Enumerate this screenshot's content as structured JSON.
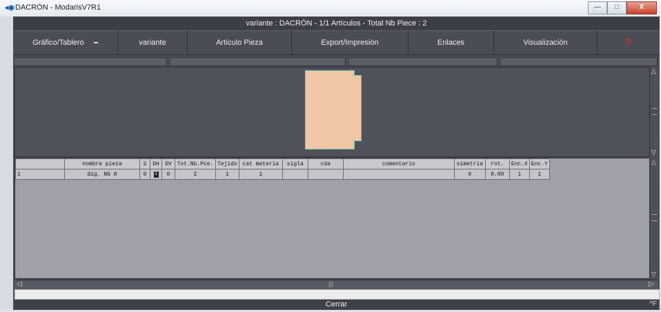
{
  "window": {
    "title": "DACRÓN - ModarisV7R1",
    "icon": "modaris-app-icon"
  },
  "window_controls": {
    "minimize": "—",
    "maximize": "□",
    "close": "X"
  },
  "header": {
    "title": "variante  :  DACRÓN  -  1/1  Artículos  -  Total Nb Piece  :  2"
  },
  "menubar": {
    "items": [
      {
        "label": "Gráfico/Tablero"
      },
      {
        "label": "variante"
      },
      {
        "label": "Artículo Pieza"
      },
      {
        "label": "Export/Impresión"
      },
      {
        "label": "Enlaces"
      },
      {
        "label": "Visualización"
      }
    ],
    "help_glyph": "?"
  },
  "table": {
    "columns": [
      "",
      "nombre pieza",
      "S",
      "DH",
      "DV",
      "Tot.Nb.Pce.",
      "Tejido",
      "cat materia",
      "sigla",
      "cda",
      "comentario",
      "simetria",
      "rot.",
      "Enc.X",
      "Enc.Y"
    ],
    "rows": [
      [
        "1",
        "dig. NG 8",
        "0",
        "1",
        "0",
        "2",
        "1",
        "1",
        "",
        "",
        "",
        "0",
        "0.00",
        "1",
        "1"
      ]
    ]
  },
  "footer": {
    "close_label": "Cerrar",
    "corner_label": "^F"
  },
  "colors": {
    "piece_fill": "#f0c6a4",
    "piece_outline": "#79c9ad",
    "help_icon": "#e22a20"
  }
}
